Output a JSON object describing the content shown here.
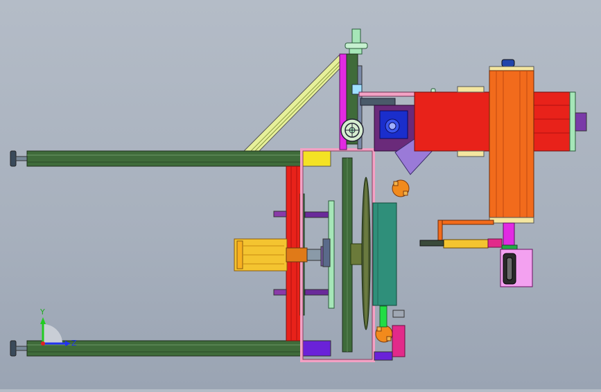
{
  "view": {
    "background_top": "#b4bcc7",
    "background_bottom": "#9aa4b3"
  },
  "triad": {
    "y_axis_label": "Y",
    "z_axis_label": "Z",
    "y_axis_color": "#22cc22",
    "z_axis_color": "#2233ee",
    "x_axis_color": "#dd2222"
  },
  "colors": {
    "rail_green": "#3f6b3a",
    "frame_red": "#e8221a",
    "motor_orange": "#f26b1c",
    "cylinder_yellow": "#f4c430",
    "pink_frame": "#f3a1c4",
    "teal_block": "#2f8f7a",
    "blue_gearbox": "#1a2ecc",
    "purple_housing": "#6a2a7a",
    "mint": "#a6e6b8",
    "magenta": "#e22ae2",
    "light_yellow_brace": "#e6f09a",
    "lavender_arm": "#9a7ad8"
  }
}
